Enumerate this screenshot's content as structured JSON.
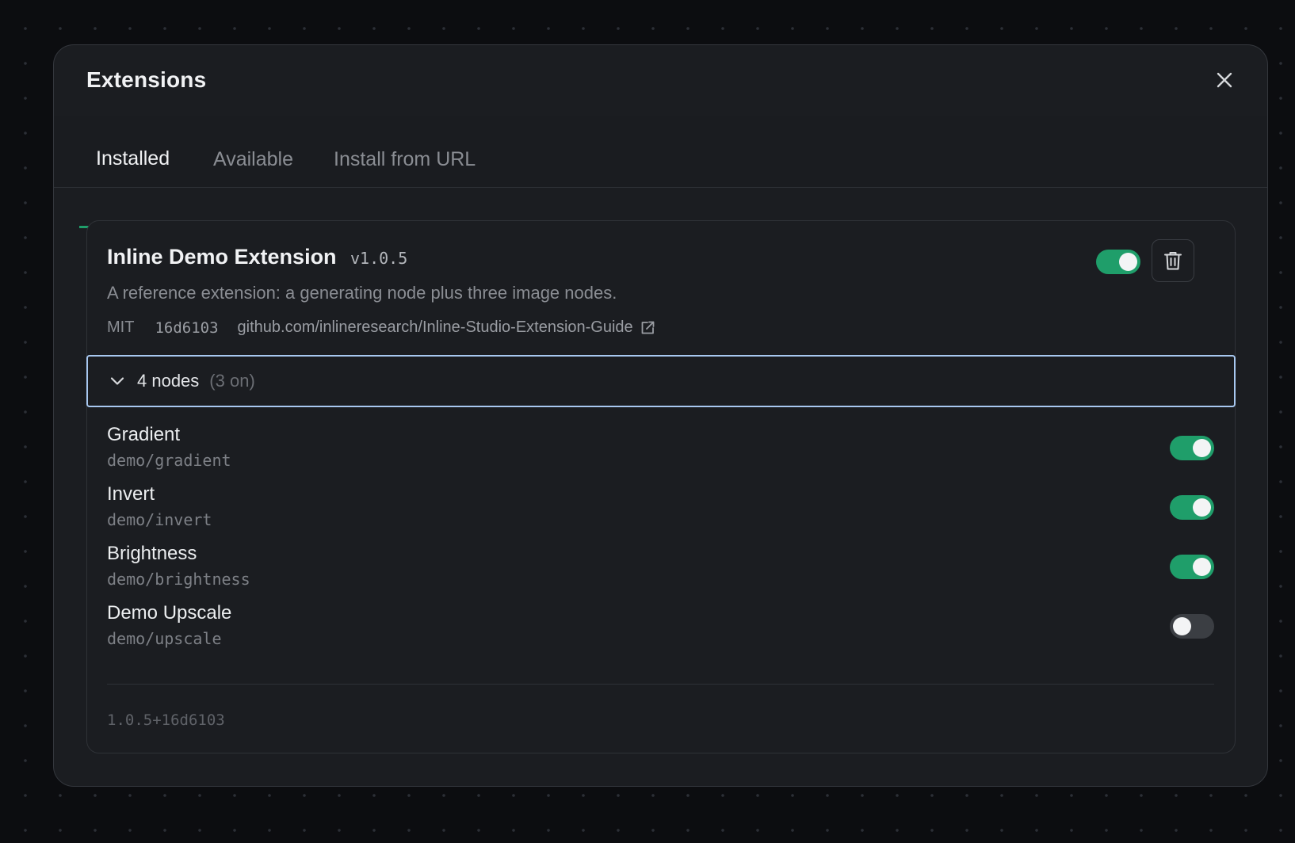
{
  "dialog": {
    "title": "Extensions",
    "close_label": "Close"
  },
  "tabs": [
    {
      "label": "Installed",
      "active": true
    },
    {
      "label": "Available",
      "active": false
    },
    {
      "label": "Install from URL",
      "active": false
    }
  ],
  "extension": {
    "name": "Inline Demo Extension",
    "version": "v1.0.5",
    "description": "A reference extension: a generating node plus three image nodes.",
    "license": "MIT",
    "commit": "16d6103",
    "repo": "github.com/inlineresearch/Inline-Studio-Extension-Guide",
    "enabled": true,
    "nodes_summary": {
      "count_label": "4 nodes",
      "on_label": "(3 on)"
    },
    "nodes": [
      {
        "title": "Gradient",
        "id": "demo/gradient",
        "enabled": true
      },
      {
        "title": "Invert",
        "id": "demo/invert",
        "enabled": true
      },
      {
        "title": "Brightness",
        "id": "demo/brightness",
        "enabled": true
      },
      {
        "title": "Demo Upscale",
        "id": "demo/upscale",
        "enabled": false
      }
    ],
    "build_id": "1.0.5+16d6103"
  },
  "icons": {
    "close": "close-icon",
    "trash": "trash-icon",
    "chevron": "chevron-down-icon",
    "external_link": "external-link-icon"
  },
  "colors": {
    "accent": "#1f9e6a",
    "focus_ring": "#a8c8f0",
    "background": "#0c0d10",
    "panel": "#1b1d21"
  }
}
